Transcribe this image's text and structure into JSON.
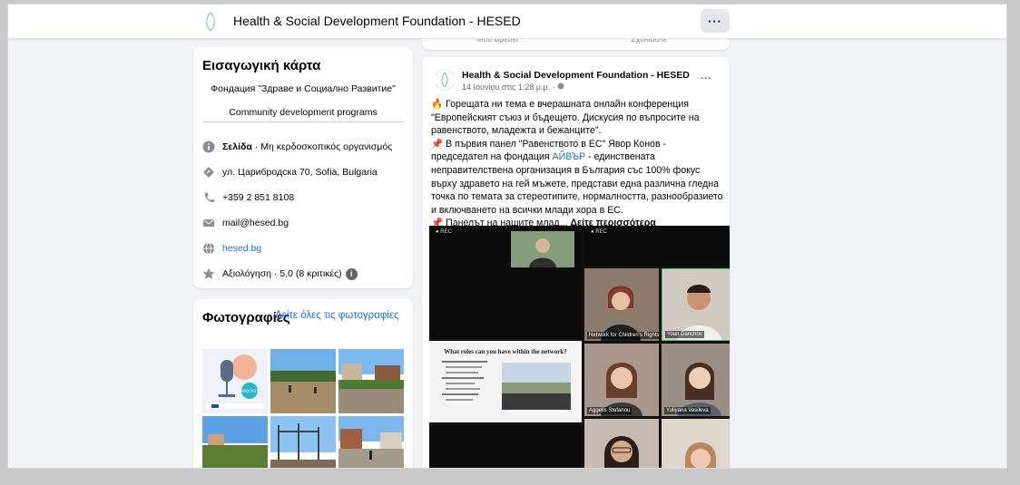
{
  "topbar": {
    "title": "Health & Social Development Foundation - HESED",
    "more_label": "···"
  },
  "intro": {
    "title": "Εισαγωγική κάρτα",
    "line1": "Фондация \"Здраве и Социално Развитие\"",
    "line2": "Community development programs",
    "rows": [
      {
        "icon": "info-icon",
        "bold": "Σελίδα",
        "text": " · Μη κερδοσκοπικός οργανισμός"
      },
      {
        "icon": "location-icon",
        "text": "ул. Царибродска 70, Sofia, Bulgaria"
      },
      {
        "icon": "phone-icon",
        "text": "+359 2 851 8108"
      },
      {
        "icon": "email-icon",
        "text": "mail@hesed.bg"
      },
      {
        "icon": "globe-icon",
        "text": "hesed.bg"
      },
      {
        "icon": "star-icon",
        "text": "Αξιολόγηση · 5,0 (8 κριτικές)"
      }
    ]
  },
  "photos": {
    "title": "Φωτογραφίες",
    "see_all": "Δείτε όλες τις φωτογραφίες"
  },
  "prev_post": {
    "action1": "Μου αρέσει",
    "action2": "Σχολιάστε"
  },
  "post": {
    "author": "Health & Social Development Foundation - HESED",
    "meta": "14 Ιουνίου στις 1:28 μ.μ. · ",
    "more_label": "···",
    "para1": "🔥 Горещата ни тема е вчерашната онлайн конференция \"Европейският съюз и бъдещето. Дискусия по въпросите на равенството, младежта и бежанците\".",
    "para2_a": "📌 В първия панел \"Равенството в ЕС\" Явор Конов - председател на фондация ",
    "para2_link": "АЙВЪР",
    "para2_b": " - единствената неправителствена организация в България със 100% фокус върху здравето на гей мъжете, представи една различна гледна точка по темата за стереотипите, нормалността, разнообразието и включването на всички млади хора в ЕС.",
    "para3": "📌 Панелът на нашите млад... ",
    "see_more": "Δείτε περισσότερα",
    "slide_title": "What roles can you have within the network?",
    "rec": "● REC",
    "names": [
      "Network for Children's Rights",
      "Yoan Danchov",
      "Aggelis Stefanou",
      "Yuliyana Vasileva"
    ]
  }
}
